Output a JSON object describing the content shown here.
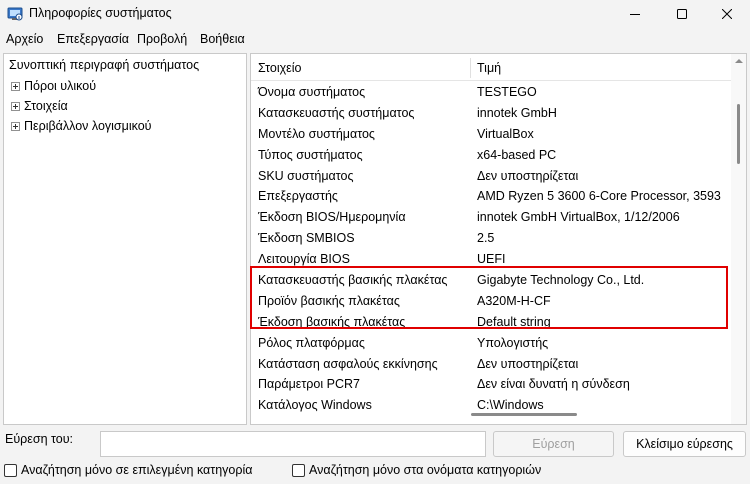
{
  "window": {
    "title": "Πληροφορίες συστήματος"
  },
  "menu": [
    "Αρχείο",
    "Επεξεργασία",
    "Προβολή",
    "Βοήθεια"
  ],
  "tree": {
    "root": "Συνοπτική περιγραφή συστήματος",
    "children": [
      "Πόροι υλικού",
      "Στοιχεία",
      "Περιβάλλον λογισμικού"
    ]
  },
  "table": {
    "headers": [
      "Στοιχείο",
      "Τιμή"
    ],
    "rows": [
      [
        "Όνομα συστήματος",
        "TESTEGO"
      ],
      [
        "Κατασκευαστής συστήματος",
        "innotek GmbH"
      ],
      [
        "Μοντέλο συστήματος",
        "VirtualBox"
      ],
      [
        "Τύπος συστήματος",
        "x64-based PC"
      ],
      [
        "SKU συστήματος",
        "Δεν υποστηρίζεται"
      ],
      [
        "Επεξεργαστής",
        "AMD Ryzen 5 3600 6-Core Processor, 3593"
      ],
      [
        "Έκδοση BIOS/Ημερομηνία",
        "innotek GmbH VirtualBox, 1/12/2006"
      ],
      [
        "Έκδοση SMBIOS",
        "2.5"
      ],
      [
        "Λειτουργία BIOS",
        "UEFI"
      ],
      [
        "Κατασκευαστής βασικής πλακέτας",
        "Gigabyte Technology Co., Ltd."
      ],
      [
        "Προϊόν βασικής πλακέτας",
        "A320M-H-CF"
      ],
      [
        "Έκδοση βασικής πλακέτας",
        "Default string"
      ],
      [
        "Ρόλος πλατφόρμας",
        "Υπολογιστής"
      ],
      [
        "Κατάσταση ασφαλούς εκκίνησης",
        "Δεν υποστηρίζεται"
      ],
      [
        "Παράμετροι PCR7",
        "Δεν είναι δυνατή η σύνδεση"
      ],
      [
        "Κατάλογος Windows",
        "C:\\Windows"
      ]
    ]
  },
  "find": {
    "label": "Εύρεση του:",
    "input_value": "",
    "search_button": "Εύρεση",
    "close_button": "Κλείσιμο εύρεσης",
    "check_selected_category": "Αναζήτηση μόνο σε επιλεγμένη κατηγορία",
    "check_category_names": "Αναζήτηση μόνο στα ονόματα κατηγοριών"
  },
  "colors": {
    "highlight": "#e00000"
  }
}
